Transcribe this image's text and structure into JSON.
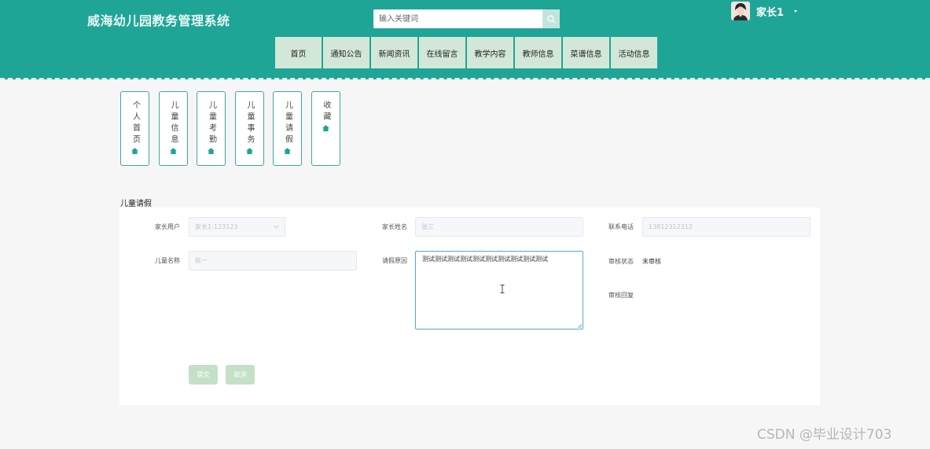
{
  "header": {
    "title": "威海幼儿园教务管理系统",
    "search_placeholder": "输入关键词",
    "user_name": "家长1"
  },
  "nav": [
    {
      "label": "首页"
    },
    {
      "label": "通知公告"
    },
    {
      "label": "新闻资讯"
    },
    {
      "label": "在线留言"
    },
    {
      "label": "教学内容"
    },
    {
      "label": "教师信息"
    },
    {
      "label": "菜谱信息"
    },
    {
      "label": "活动信息"
    }
  ],
  "tiles": [
    {
      "label": "个人首页"
    },
    {
      "label": "儿童信息"
    },
    {
      "label": "儿童考勤"
    },
    {
      "label": "儿童事务"
    },
    {
      "label": "儿童请假"
    },
    {
      "label": "收藏"
    }
  ],
  "section_title": "儿童请假",
  "form": {
    "parent_user_label": "家长用户",
    "parent_user_value": "家长1-123123",
    "parent_name_label": "家长姓名",
    "parent_name_value": "张三",
    "phone_label": "联系电话",
    "phone_value": "13812312312",
    "child_name_label": "儿童名称",
    "child_name_value": "陈一",
    "reason_label": "请假原因",
    "reason_value": "测试测试测试测试测试测试测试测试测试测试",
    "review_status_label": "审核状态",
    "review_status_value": "未审核",
    "review_reply_label": "审核回复",
    "submit_label": "提交",
    "cancel_label": "取消"
  },
  "watermark": "CSDN @毕业设计703",
  "colors": {
    "header_bg": "#1fa596",
    "nav_bg": "#d3e7d8",
    "tile_border": "#3ea8a0",
    "button_bg": "#c6e0c8",
    "textarea_border": "#53a9d8"
  },
  "icons": {
    "search": "search-icon",
    "tile": "home-icon",
    "caret": "caret-down-icon",
    "select": "chevron-down-icon"
  }
}
